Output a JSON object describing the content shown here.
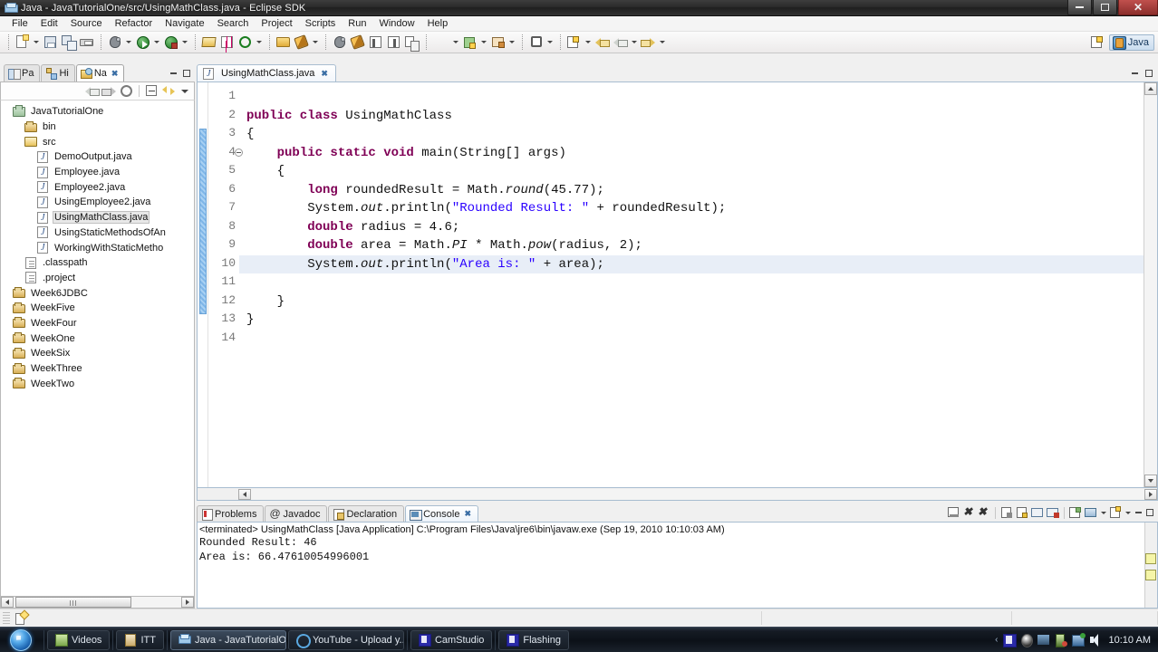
{
  "window": {
    "title": "Java - JavaTutorialOne/src/UsingMathClass.java - Eclipse SDK",
    "icon": "eclipse-icon",
    "minimize_label": "—",
    "maximize_label": "❐",
    "close_label": "✕"
  },
  "menubar": {
    "items": [
      {
        "label": "File"
      },
      {
        "label": "Edit"
      },
      {
        "label": "Source"
      },
      {
        "label": "Refactor"
      },
      {
        "label": "Navigate"
      },
      {
        "label": "Search"
      },
      {
        "label": "Project"
      },
      {
        "label": "Scripts"
      },
      {
        "label": "Run"
      },
      {
        "label": "Window"
      },
      {
        "label": "Help"
      }
    ]
  },
  "toolbar": {
    "perspective": {
      "label": "Java",
      "icon": "java-perspective-icon"
    },
    "open_perspective_icon": "open-perspective-icon",
    "icons": [
      "new-icon",
      "save-icon",
      "save-all-icon",
      "print-icon",
      "debug-icon",
      "run-icon",
      "run-external-tools-icon",
      "new-java-project-icon",
      "new-package-icon",
      "new-class-icon",
      "open-type-icon",
      "search-icon",
      "toggle-mark-occurrences-icon",
      "show-whitespace-icon",
      "block-comment-icon",
      "next-annotation-icon",
      "previous-annotation-icon",
      "last-edit-location-icon",
      "back-icon",
      "forward-icon"
    ]
  },
  "left_panel": {
    "tabs": [
      {
        "label": "Pa",
        "icon": "package-explorer-icon",
        "active": false
      },
      {
        "label": "Hi",
        "icon": "type-hierarchy-icon",
        "active": false
      },
      {
        "label": "Na",
        "icon": "navigator-icon",
        "active": true,
        "close": "✖"
      }
    ],
    "view_toolbar": [
      "back-icon",
      "forward-icon",
      "home-icon",
      "collapse-all-icon",
      "link-with-editor-icon",
      "view-menu-icon"
    ],
    "minimize_label": "—",
    "maximize_label": "❐",
    "tree": [
      {
        "label": "JavaTutorialOne",
        "indent": 0,
        "icon": "project-open-icon",
        "selected": false
      },
      {
        "label": "bin",
        "indent": 1,
        "icon": "folder-icon",
        "selected": false
      },
      {
        "label": "src",
        "indent": 1,
        "icon": "folder-open-icon",
        "selected": false
      },
      {
        "label": "DemoOutput.java",
        "indent": 2,
        "icon": "java-file-icon",
        "selected": false
      },
      {
        "label": "Employee.java",
        "indent": 2,
        "icon": "java-file-icon",
        "selected": false
      },
      {
        "label": "Employee2.java",
        "indent": 2,
        "icon": "java-file-icon",
        "selected": false
      },
      {
        "label": "UsingEmployee2.java",
        "indent": 2,
        "icon": "java-file-icon",
        "selected": false
      },
      {
        "label": "UsingMathClass.java",
        "indent": 2,
        "icon": "java-file-icon",
        "selected": true
      },
      {
        "label": "UsingStaticMethodsOfAn",
        "indent": 2,
        "icon": "java-file-icon",
        "selected": false
      },
      {
        "label": "WorkingWithStaticMetho",
        "indent": 2,
        "icon": "java-file-icon",
        "selected": false
      },
      {
        "label": ".classpath",
        "indent": 1,
        "icon": "file-icon",
        "selected": false
      },
      {
        "label": ".project",
        "indent": 1,
        "icon": "file-icon",
        "selected": false
      },
      {
        "label": "Week6JDBC",
        "indent": 0,
        "icon": "folder-icon",
        "selected": false
      },
      {
        "label": "WeekFive",
        "indent": 0,
        "icon": "folder-icon",
        "selected": false
      },
      {
        "label": "WeekFour",
        "indent": 0,
        "icon": "folder-icon",
        "selected": false
      },
      {
        "label": "WeekOne",
        "indent": 0,
        "icon": "folder-icon",
        "selected": false
      },
      {
        "label": "WeekSix",
        "indent": 0,
        "icon": "folder-icon",
        "selected": false
      },
      {
        "label": "WeekThree",
        "indent": 0,
        "icon": "folder-icon",
        "selected": false
      },
      {
        "label": "WeekTwo",
        "indent": 0,
        "icon": "folder-icon",
        "selected": false
      }
    ]
  },
  "editor": {
    "tab": {
      "label": "UsingMathClass.java",
      "icon": "java-file-icon",
      "close": "✖"
    },
    "minimize_label": "—",
    "maximize_label": "❐",
    "current_line": 10,
    "fold_line": 4,
    "lines": [
      {
        "n": 1,
        "html": ""
      },
      {
        "n": 2,
        "html": "<span class='kw'>public class</span> UsingMathClass"
      },
      {
        "n": 3,
        "html": "{"
      },
      {
        "n": 4,
        "html": "    <span class='kw'>public static void</span> main(String[] args)"
      },
      {
        "n": 5,
        "html": "    {"
      },
      {
        "n": 6,
        "html": "        <span class='kw'>long</span> roundedResult = Math.<span class='stat'>round</span>(45.77);"
      },
      {
        "n": 7,
        "html": "        System.<span class='stat'>out</span>.println(<span class='str'>\"Rounded Result: \"</span> + roundedResult);"
      },
      {
        "n": 8,
        "html": "        <span class='kw'>double</span> radius = 4.6;"
      },
      {
        "n": 9,
        "html": "        <span class='kw'>double</span> area = Math.<span class='stat'>PI</span> * Math.<span class='stat'>pow</span>(radius, 2);"
      },
      {
        "n": 10,
        "html": "        System.<span class='stat'>out</span>.println(<span class='str'>\"Area is: \"</span> + area);"
      },
      {
        "n": 11,
        "html": ""
      },
      {
        "n": 12,
        "html": "    }"
      },
      {
        "n": 13,
        "html": "}"
      },
      {
        "n": 14,
        "html": ""
      }
    ]
  },
  "console": {
    "tabs": [
      {
        "label": "Problems",
        "icon": "problems-icon",
        "active": false
      },
      {
        "label": "Javadoc",
        "icon": "javadoc-icon",
        "active": false
      },
      {
        "label": "Declaration",
        "icon": "declaration-icon",
        "active": false
      },
      {
        "label": "Console",
        "icon": "console-icon",
        "active": true,
        "close": "✖"
      }
    ],
    "toolbar_icons": [
      "clear-console-icon",
      "terminate-icon",
      "remove-all-terminated-icon",
      "scroll-lock-icon",
      "show-console-on-output-icon",
      "display-selected-console-icon",
      "remove-launch-icon",
      "open-console-icon",
      "pin-console-icon",
      "new-console-view-icon"
    ],
    "minimize_label": "—",
    "maximize_label": "❐",
    "header": "<terminated> UsingMathClass [Java Application] C:\\Program Files\\Java\\jre6\\bin\\javaw.exe (Sep 19, 2010 10:10:03 AM)",
    "output": [
      "Rounded Result: 46",
      "Area is: 66.47610054996001"
    ]
  },
  "statusbar": {
    "icon": "writable-mode-icon"
  },
  "taskbar": {
    "start_label": "start-orb",
    "buttons": [
      {
        "label": "Videos",
        "icon": "videos-icon",
        "active": false
      },
      {
        "label": "ITT",
        "icon": "itt-icon",
        "active": false
      },
      {
        "label": "Java - JavaTutorialO...",
        "icon": "eclipse-icon",
        "active": true
      },
      {
        "label": "YouTube - Upload y...",
        "icon": "internet-explorer-icon",
        "active": false
      },
      {
        "label": "CamStudio",
        "icon": "camstudio-icon",
        "active": false
      },
      {
        "label": "Flashing",
        "icon": "camstudio-icon",
        "active": false
      }
    ],
    "tray": {
      "chevron": "‹",
      "icons": [
        "camstudio-tray-icon",
        "bluetooth-icon",
        "network-monitor-icon",
        "battery-icon",
        "network-icon",
        "volume-icon"
      ],
      "clock": "10:10 AM"
    }
  }
}
